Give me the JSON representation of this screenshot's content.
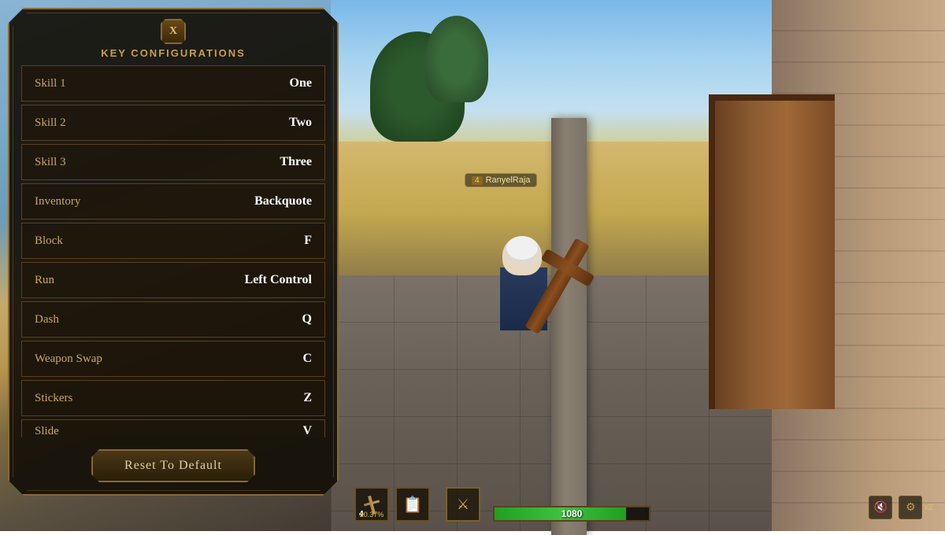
{
  "panel": {
    "title": "KEY CONFIGURATIONS",
    "close_label": "X",
    "keybinds": [
      {
        "label": "Skill 1",
        "value": "One"
      },
      {
        "label": "Skill 2",
        "value": "Two"
      },
      {
        "label": "Skill 3",
        "value": "Three"
      },
      {
        "label": "Inventory",
        "value": "Backquote"
      },
      {
        "label": "Block",
        "value": "F"
      },
      {
        "label": "Run",
        "value": "Left Control"
      },
      {
        "label": "Dash",
        "value": "Q"
      },
      {
        "label": "Weapon Swap",
        "value": "C"
      },
      {
        "label": "Stickers",
        "value": "Z"
      },
      {
        "label": "Slide",
        "value": "V"
      }
    ],
    "reset_label": "Reset To Default"
  },
  "hud": {
    "player_name": "RanyelRaja",
    "player_level": "4",
    "health_current": "1080",
    "health_pct": 85,
    "inventory_count": "4",
    "inventory_pct": "20.37%",
    "x2_label": "x2"
  }
}
